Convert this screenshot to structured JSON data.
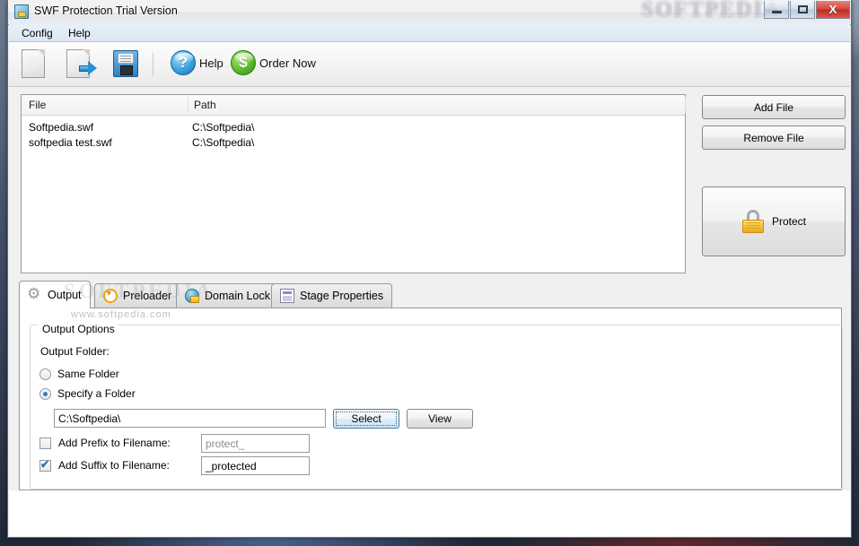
{
  "window": {
    "title": "SWF Protection Trial Version",
    "app_icon": "swf-app-icon",
    "watermark_title": "SOFTPEDIA",
    "controls": {
      "minimize": "minimize-button",
      "maximize": "maximize-button",
      "close_label": "X"
    }
  },
  "menu": {
    "items": [
      {
        "label": "Config"
      },
      {
        "label": "Help"
      }
    ]
  },
  "toolbar": {
    "new_icon": "new-document-icon",
    "export_icon": "export-document-icon",
    "save_icon": "save-floppy-icon",
    "help_icon": "help-question-icon",
    "help_label": "Help",
    "order_icon": "order-dollar-icon",
    "order_label": "Order Now"
  },
  "file_list": {
    "columns": [
      "File",
      "Path"
    ],
    "rows": [
      {
        "file": "Softpedia.swf",
        "path": "C:\\Softpedia\\"
      },
      {
        "file": "softpedia test.swf",
        "path": "C:\\Softpedia\\"
      }
    ]
  },
  "side_buttons": {
    "add_file": "Add File",
    "remove_file": "Remove File",
    "protect": "Protect",
    "protect_icon": "lock-icon"
  },
  "tabs": [
    {
      "label": "Output",
      "icon": "gear-icon",
      "active": true
    },
    {
      "label": "Preloader",
      "icon": "clock-icon",
      "active": false
    },
    {
      "label": "Domain Lock",
      "icon": "globe-lock-icon",
      "active": false
    },
    {
      "label": "Stage Properties",
      "icon": "stage-properties-icon",
      "active": false
    }
  ],
  "watermarks": {
    "big": "SOFTPEDIA",
    "small": "www.softpedia.com"
  },
  "output_options": {
    "group_title": "Output Options",
    "output_folder_label": "Output Folder:",
    "same_folder": {
      "label": "Same Folder",
      "checked": false
    },
    "specify_folder": {
      "label": "Specify a Folder",
      "checked": true
    },
    "folder_value": "C:\\Softpedia\\",
    "select_button": "Select",
    "view_button": "View",
    "prefix": {
      "label": "Add Prefix to Filename:",
      "checked": false,
      "value": "",
      "placeholder": "protect_"
    },
    "suffix": {
      "label": "Add Suffix to Filename:",
      "checked": true,
      "value": "_protected",
      "placeholder": ""
    }
  },
  "colors": {
    "accent_blue": "#2f7fc0",
    "close_red": "#c0392b",
    "lock_yellow": "#f5c13a",
    "order_green": "#5bbd2c"
  }
}
